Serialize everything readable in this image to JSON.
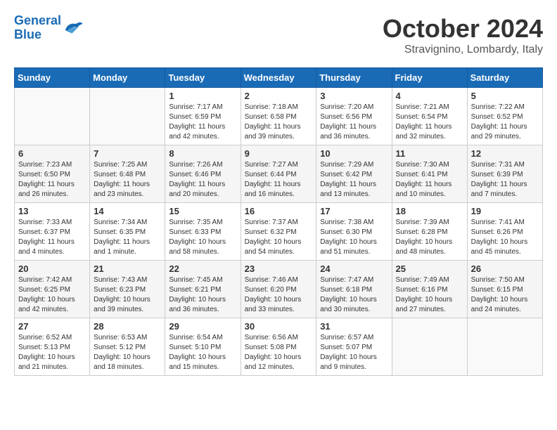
{
  "logo": {
    "line1": "General",
    "line2": "Blue"
  },
  "title": "October 2024",
  "location": "Stravignino, Lombardy, Italy",
  "headers": [
    "Sunday",
    "Monday",
    "Tuesday",
    "Wednesday",
    "Thursday",
    "Friday",
    "Saturday"
  ],
  "weeks": [
    [
      {
        "day": "",
        "info": ""
      },
      {
        "day": "",
        "info": ""
      },
      {
        "day": "1",
        "info": "Sunrise: 7:17 AM\nSunset: 6:59 PM\nDaylight: 11 hours and 42 minutes."
      },
      {
        "day": "2",
        "info": "Sunrise: 7:18 AM\nSunset: 6:58 PM\nDaylight: 11 hours and 39 minutes."
      },
      {
        "day": "3",
        "info": "Sunrise: 7:20 AM\nSunset: 6:56 PM\nDaylight: 11 hours and 36 minutes."
      },
      {
        "day": "4",
        "info": "Sunrise: 7:21 AM\nSunset: 6:54 PM\nDaylight: 11 hours and 32 minutes."
      },
      {
        "day": "5",
        "info": "Sunrise: 7:22 AM\nSunset: 6:52 PM\nDaylight: 11 hours and 29 minutes."
      }
    ],
    [
      {
        "day": "6",
        "info": "Sunrise: 7:23 AM\nSunset: 6:50 PM\nDaylight: 11 hours and 26 minutes."
      },
      {
        "day": "7",
        "info": "Sunrise: 7:25 AM\nSunset: 6:48 PM\nDaylight: 11 hours and 23 minutes."
      },
      {
        "day": "8",
        "info": "Sunrise: 7:26 AM\nSunset: 6:46 PM\nDaylight: 11 hours and 20 minutes."
      },
      {
        "day": "9",
        "info": "Sunrise: 7:27 AM\nSunset: 6:44 PM\nDaylight: 11 hours and 16 minutes."
      },
      {
        "day": "10",
        "info": "Sunrise: 7:29 AM\nSunset: 6:42 PM\nDaylight: 11 hours and 13 minutes."
      },
      {
        "day": "11",
        "info": "Sunrise: 7:30 AM\nSunset: 6:41 PM\nDaylight: 11 hours and 10 minutes."
      },
      {
        "day": "12",
        "info": "Sunrise: 7:31 AM\nSunset: 6:39 PM\nDaylight: 11 hours and 7 minutes."
      }
    ],
    [
      {
        "day": "13",
        "info": "Sunrise: 7:33 AM\nSunset: 6:37 PM\nDaylight: 11 hours and 4 minutes."
      },
      {
        "day": "14",
        "info": "Sunrise: 7:34 AM\nSunset: 6:35 PM\nDaylight: 11 hours and 1 minute."
      },
      {
        "day": "15",
        "info": "Sunrise: 7:35 AM\nSunset: 6:33 PM\nDaylight: 10 hours and 58 minutes."
      },
      {
        "day": "16",
        "info": "Sunrise: 7:37 AM\nSunset: 6:32 PM\nDaylight: 10 hours and 54 minutes."
      },
      {
        "day": "17",
        "info": "Sunrise: 7:38 AM\nSunset: 6:30 PM\nDaylight: 10 hours and 51 minutes."
      },
      {
        "day": "18",
        "info": "Sunrise: 7:39 AM\nSunset: 6:28 PM\nDaylight: 10 hours and 48 minutes."
      },
      {
        "day": "19",
        "info": "Sunrise: 7:41 AM\nSunset: 6:26 PM\nDaylight: 10 hours and 45 minutes."
      }
    ],
    [
      {
        "day": "20",
        "info": "Sunrise: 7:42 AM\nSunset: 6:25 PM\nDaylight: 10 hours and 42 minutes."
      },
      {
        "day": "21",
        "info": "Sunrise: 7:43 AM\nSunset: 6:23 PM\nDaylight: 10 hours and 39 minutes."
      },
      {
        "day": "22",
        "info": "Sunrise: 7:45 AM\nSunset: 6:21 PM\nDaylight: 10 hours and 36 minutes."
      },
      {
        "day": "23",
        "info": "Sunrise: 7:46 AM\nSunset: 6:20 PM\nDaylight: 10 hours and 33 minutes."
      },
      {
        "day": "24",
        "info": "Sunrise: 7:47 AM\nSunset: 6:18 PM\nDaylight: 10 hours and 30 minutes."
      },
      {
        "day": "25",
        "info": "Sunrise: 7:49 AM\nSunset: 6:16 PM\nDaylight: 10 hours and 27 minutes."
      },
      {
        "day": "26",
        "info": "Sunrise: 7:50 AM\nSunset: 6:15 PM\nDaylight: 10 hours and 24 minutes."
      }
    ],
    [
      {
        "day": "27",
        "info": "Sunrise: 6:52 AM\nSunset: 5:13 PM\nDaylight: 10 hours and 21 minutes."
      },
      {
        "day": "28",
        "info": "Sunrise: 6:53 AM\nSunset: 5:12 PM\nDaylight: 10 hours and 18 minutes."
      },
      {
        "day": "29",
        "info": "Sunrise: 6:54 AM\nSunset: 5:10 PM\nDaylight: 10 hours and 15 minutes."
      },
      {
        "day": "30",
        "info": "Sunrise: 6:56 AM\nSunset: 5:08 PM\nDaylight: 10 hours and 12 minutes."
      },
      {
        "day": "31",
        "info": "Sunrise: 6:57 AM\nSunset: 5:07 PM\nDaylight: 10 hours and 9 minutes."
      },
      {
        "day": "",
        "info": ""
      },
      {
        "day": "",
        "info": ""
      }
    ]
  ]
}
